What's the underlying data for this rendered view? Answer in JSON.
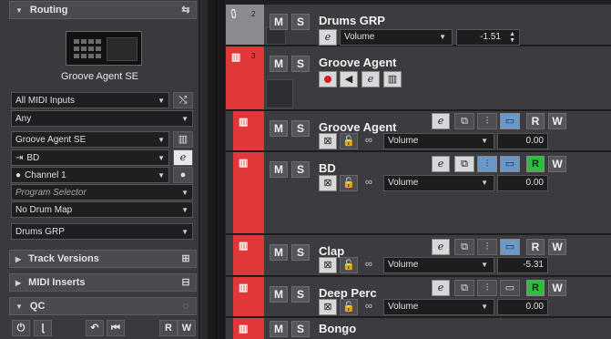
{
  "inspector": {
    "routing": {
      "title": "Routing",
      "instrument_name": "Groove Agent SE"
    },
    "fields": {
      "midi_input": "All MIDI Inputs",
      "channel_filter": "Any",
      "output_instrument": "Groove Agent SE",
      "output_sub": "BD",
      "channel": "Channel 1",
      "program_selector": "Program Selector",
      "drum_map": "No Drum Map",
      "group": "Drums GRP"
    },
    "sections": {
      "track_versions": "Track Versions",
      "midi_inserts": "MIDI Inserts",
      "qc": "QC"
    },
    "qc_buttons": {
      "read": "R",
      "write": "W"
    }
  },
  "tracks": [
    {
      "name": "Drums GRP",
      "number": "2",
      "param": "Volume",
      "value": "-1.51"
    },
    {
      "name": "Groove Agent",
      "number": "3"
    },
    {
      "name": "Groove Agent",
      "param": "Volume",
      "value": "0.00"
    },
    {
      "name": "BD",
      "param": "Volume",
      "value": "0.00"
    },
    {
      "name": "Clap",
      "param": "Volume",
      "value": "-5.31"
    },
    {
      "name": "Deep Perc",
      "param": "Volume",
      "value": "0.00"
    },
    {
      "name": "Bongo"
    }
  ],
  "labels": {
    "mute": "M",
    "solo": "S",
    "read": "R",
    "write": "W"
  },
  "colors": {
    "track_red": "#e03838",
    "folder_grey": "#8a8a8f",
    "monitor_blue": "#6a98c8",
    "read_green": "#2fbf3f"
  }
}
